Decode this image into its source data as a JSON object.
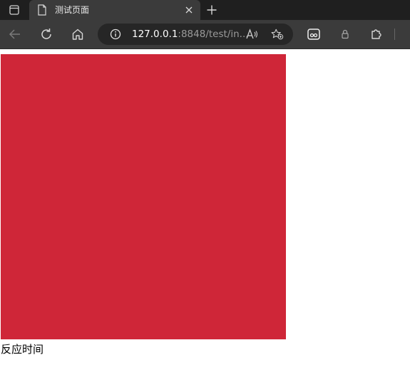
{
  "browser": {
    "tab": {
      "title": "测试页面"
    },
    "address_bar": {
      "url_host": "127.0.0.1",
      "url_rest": ":8848/test/in..."
    }
  },
  "page": {
    "box_color": "#cf2638",
    "caption": "反应时间"
  },
  "colors": {
    "tabbar_bg": "#1f1f1f",
    "toolbar_bg": "#3b3b3b",
    "omnibox_bg": "#262626",
    "page_bg": "#ffffff"
  },
  "icons": [
    "tab-actions-icon",
    "page-icon",
    "close-icon",
    "plus-icon",
    "back-icon",
    "refresh-icon",
    "home-icon",
    "info-icon",
    "read-aloud-icon",
    "favorite-add-icon",
    "extension-icon",
    "lock-icon",
    "puzzle-icon"
  ]
}
